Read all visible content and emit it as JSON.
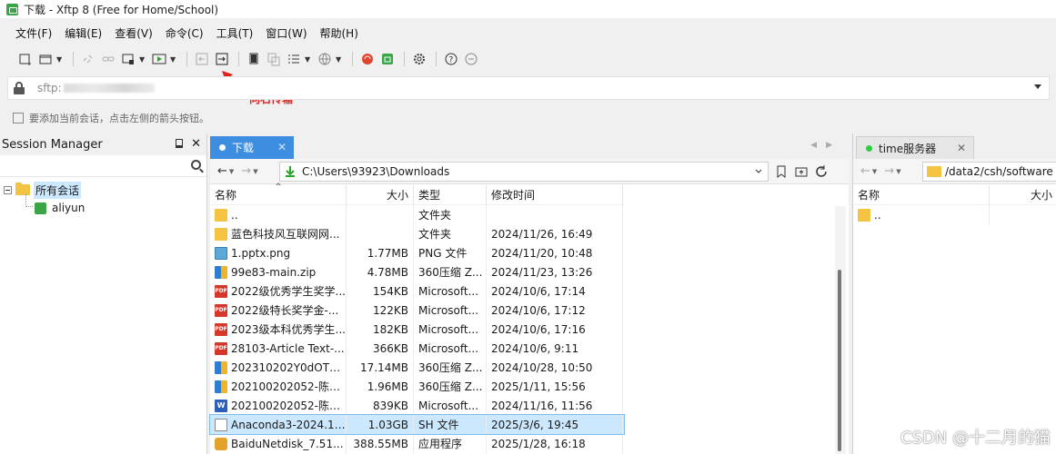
{
  "window": {
    "title": "下载 - Xftp 8 (Free for Home/School)"
  },
  "menu": [
    "文件(F)",
    "编辑(E)",
    "查看(V)",
    "命令(C)",
    "工具(T)",
    "窗口(W)",
    "帮助(H)"
  ],
  "address": {
    "text": "sftp:"
  },
  "annotation": {
    "label": "向右传输"
  },
  "hint": {
    "text": "要添加当前会话，点击左侧的箭头按钮。"
  },
  "session_manager": {
    "title": "Session Manager",
    "root": "所有会话",
    "sessions": [
      "aliyun"
    ]
  },
  "local": {
    "tab_label": "下载",
    "path": "C:\\Users\\93923\\Downloads",
    "columns": {
      "name": "名称",
      "size": "大小",
      "type": "类型",
      "time": "修改时间"
    },
    "files": [
      {
        "icon": "folder",
        "name": "..",
        "size": "",
        "type": "文件夹",
        "time": ""
      },
      {
        "icon": "folder",
        "name": "蓝色科技风互联网网...",
        "size": "",
        "type": "文件夹",
        "time": "2024/11/26, 16:49"
      },
      {
        "icon": "png",
        "name": "1.pptx.png",
        "size": "1.77MB",
        "type": "PNG 文件",
        "time": "2024/11/20, 10:48"
      },
      {
        "icon": "zip",
        "name": "99e83-main.zip",
        "size": "4.78MB",
        "type": "360压缩 Z...",
        "time": "2024/11/23, 13:26"
      },
      {
        "icon": "pdf",
        "name": "2022级优秀学生奖学...",
        "size": "154KB",
        "type": "Microsoft...",
        "time": "2024/10/6, 17:14"
      },
      {
        "icon": "pdf",
        "name": "2022级特长奖学金-...",
        "size": "122KB",
        "type": "Microsoft...",
        "time": "2024/10/6, 17:12"
      },
      {
        "icon": "pdf",
        "name": "2023级本科优秀学生...",
        "size": "182KB",
        "type": "Microsoft...",
        "time": "2024/10/6, 17:16"
      },
      {
        "icon": "pdf",
        "name": "28103-Article Text-...",
        "size": "366KB",
        "type": "Microsoft...",
        "time": "2024/10/6, 9:11"
      },
      {
        "icon": "zip",
        "name": "202310202Y0dOTU...",
        "size": "17.14MB",
        "type": "360压缩 Z...",
        "time": "2024/10/28, 10:50"
      },
      {
        "icon": "zip",
        "name": "202100202052-陈晟...",
        "size": "1.96MB",
        "type": "360压缩 Z...",
        "time": "2025/1/11, 15:56"
      },
      {
        "icon": "doc",
        "name": "202100202052-陈晟...",
        "size": "839KB",
        "type": "Microsoft...",
        "time": "2024/11/16, 11:56"
      },
      {
        "icon": "sh",
        "name": "Anaconda3-2024.10...",
        "size": "1.03GB",
        "type": "SH 文件",
        "time": "2025/3/6, 19:45",
        "selected": true
      },
      {
        "icon": "app",
        "name": "BaiduNetdisk_7.51...",
        "size": "388.55MB",
        "type": "应用程序",
        "time": "2025/1/28, 16:18"
      }
    ]
  },
  "remote": {
    "tab_label": "time服务器",
    "path": "/data2/csh/software",
    "columns": {
      "name": "名称",
      "size": "大小"
    },
    "files": [
      {
        "icon": "folder",
        "name": ".."
      }
    ]
  },
  "watermark": "CSDN @十二月的猫",
  "colors": {
    "accent": "#3d8ee0",
    "selection": "#cce8ff",
    "annotation": "#e0201c",
    "session_green": "#3aa547"
  }
}
